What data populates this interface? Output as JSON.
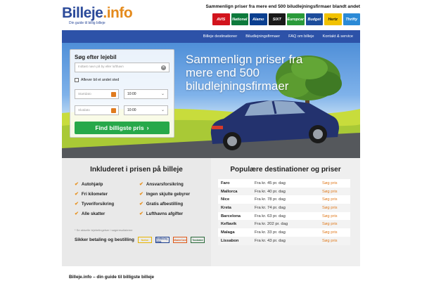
{
  "logo": {
    "name": "Billeje",
    "suffix": ".info",
    "tagline": "Din guide til billig billeje"
  },
  "header": {
    "tagline": "Sammenlign priser fra mere end 500 biludlejningsfirmaer blandt andet",
    "brands": [
      {
        "label": "AVIS",
        "color": "#d2141d"
      },
      {
        "label": "National",
        "color": "#0d7a3c"
      },
      {
        "label": "Alamo",
        "color": "#0b3f8f"
      },
      {
        "label": "SIXT",
        "color": "#1a1a1a"
      },
      {
        "label": "Europcar",
        "color": "#2a9a3a"
      },
      {
        "label": "Budget",
        "color": "#1d4d9b"
      },
      {
        "label": "Hertz",
        "color": "#f2c200"
      },
      {
        "label": "Thrifty",
        "color": "#2b8ad6"
      }
    ]
  },
  "nav": {
    "items": [
      "Billeje destinationer",
      "Biludlejningsfirmaer",
      "FAQ om billeje",
      "Kontakt & service"
    ]
  },
  "hero": {
    "headline": "Sammenlign priser fra mere end 500 biludlejningsfirmaer"
  },
  "search": {
    "title": "Søg efter lejebil",
    "location_placeholder": "Indtast navn på by eller lufthavn",
    "return_elsewhere": "Aflever bil et andet sted",
    "start_date_placeholder": "Startdato",
    "end_date_placeholder": "Slutdato",
    "start_time": "10:00",
    "end_time": "10:00",
    "button": "Find billigste pris"
  },
  "included": {
    "title": "Inkluderet i prisen på billeje",
    "items": [
      "Autohjælp",
      "Ansvarsforsikring",
      "Fri kilometer",
      "Ingen skjulte gebyrer",
      "Tyveriforsikring",
      "Gratis afbestilling",
      "Alle skatter",
      "Lufthavns afgifter"
    ],
    "note": "* Se aktuelle lejebetingelser i søgeresultaterne",
    "secure": "Sikker betaling og bestilling",
    "payments": [
      {
        "label": "Norton",
        "color": "#e8b500"
      },
      {
        "label": "Verified by VISA",
        "color": "#1a3d8f"
      },
      {
        "label": "MasterCard",
        "color": "#e05a1a"
      },
      {
        "label": "Trustwave",
        "color": "#2a6a3a"
      }
    ]
  },
  "destinations": {
    "title": "Populære destinationer og priser",
    "rows": [
      {
        "name": "Faro",
        "price": "Fra kr. 45 pr. dag",
        "link": "Søg pris"
      },
      {
        "name": "Mallorca",
        "price": "Fra kr. 40 pr. dag",
        "link": "Søg pris"
      },
      {
        "name": "Nice",
        "price": "Fra kr. 78 pr. dag",
        "link": "Søg pris"
      },
      {
        "name": "Kreta",
        "price": "Fra kr. 74 pr. dag",
        "link": "Søg pris"
      },
      {
        "name": "Barcelona",
        "price": "Fra kr. 63 pr. dag",
        "link": "Søg pris"
      },
      {
        "name": "Keflavik",
        "price": "Fra kr. 202 pr. dag",
        "link": "Søg pris"
      },
      {
        "name": "Malaga",
        "price": "Fra kr. 33 pr. dag",
        "link": "Søg pris"
      },
      {
        "name": "Lissabon",
        "price": "Fra kr. 43 pr. dag",
        "link": "Søg pris"
      }
    ]
  },
  "footer": {
    "heading": "Billeje.info – din guide til billigste billeje"
  }
}
